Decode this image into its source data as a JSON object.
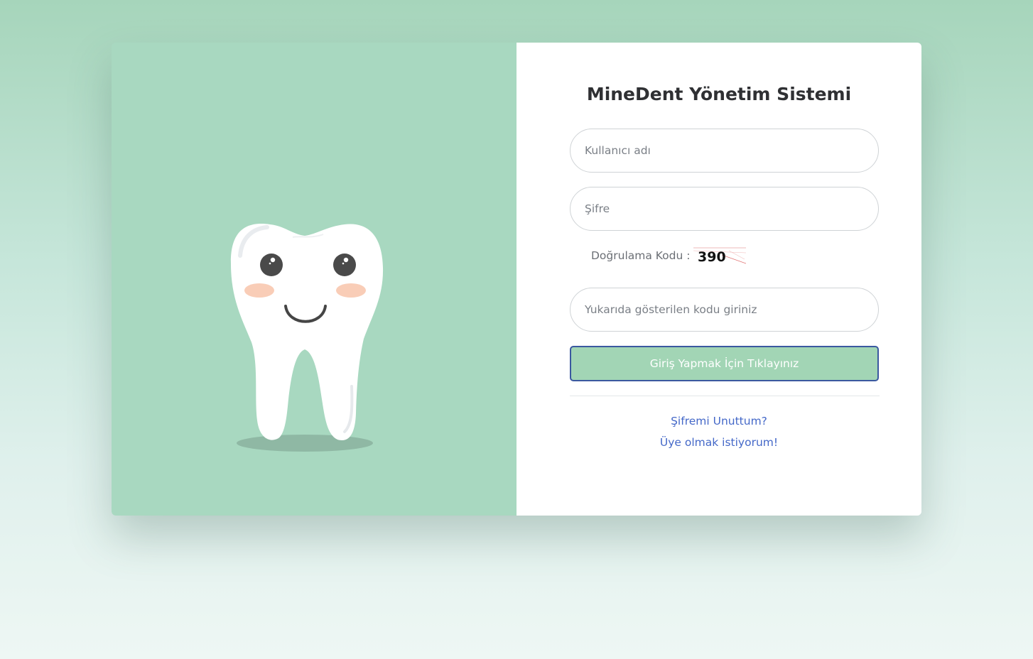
{
  "login": {
    "title": "MineDent Yönetim Sistemi",
    "username_placeholder": "Kullanıcı adı",
    "password_placeholder": "Şifre",
    "captcha_label": "Doğrulama Kodu :",
    "captcha_code": "390",
    "captcha_input_placeholder": "Yukarıda gösterilen kodu giriniz",
    "submit_label": "Giriş Yapmak İçin Tıklayınız",
    "forgot_password_link": "Şifremi Unuttum?",
    "register_link": "Üye olmak istiyorum!"
  },
  "illustration": {
    "icon": "tooth-mascot-icon"
  },
  "colors": {
    "brand_green": "#a8d8c0",
    "button_green": "#a2d5b5",
    "button_border": "#3a58a0",
    "link_blue": "#4468c8",
    "title_text": "#2f3033"
  }
}
